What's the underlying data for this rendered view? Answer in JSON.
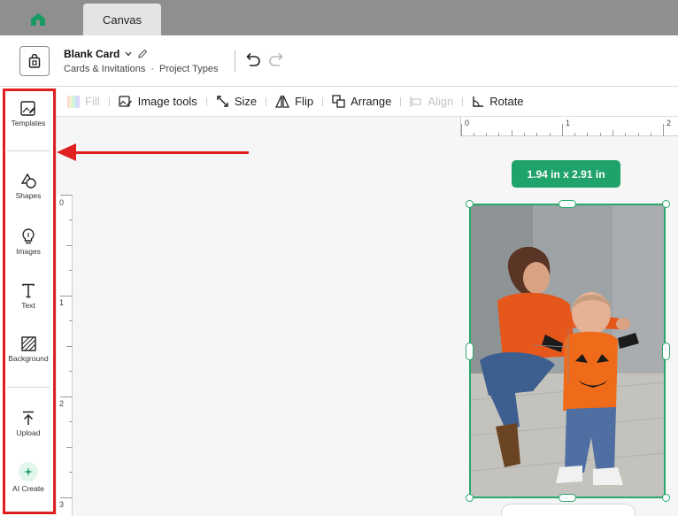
{
  "tabs": {
    "active_label": "Canvas"
  },
  "header": {
    "project_name": "Blank Card",
    "category": "Cards & Invitations",
    "separator": "·",
    "project_types": "Project Types"
  },
  "toolbar": {
    "fill": "Fill",
    "image_tools": "Image tools",
    "size": "Size",
    "flip": "Flip",
    "arrange": "Arrange",
    "align": "Align",
    "rotate": "Rotate"
  },
  "sidebar": {
    "templates": "Templates",
    "shapes": "Shapes",
    "images": "Images",
    "text": "Text",
    "background": "Background",
    "upload": "Upload",
    "ai_create": "AI Create"
  },
  "ruler": {
    "h_labels": [
      "0",
      "1",
      "2"
    ],
    "v_labels": [
      "0",
      "1",
      "2",
      "3"
    ]
  },
  "selection": {
    "size_badge": "1.94  in x 2.91  in"
  },
  "colors": {
    "accent": "#1fa36a",
    "highlight": "#e02020",
    "tabbar": "#8f8f8f"
  }
}
